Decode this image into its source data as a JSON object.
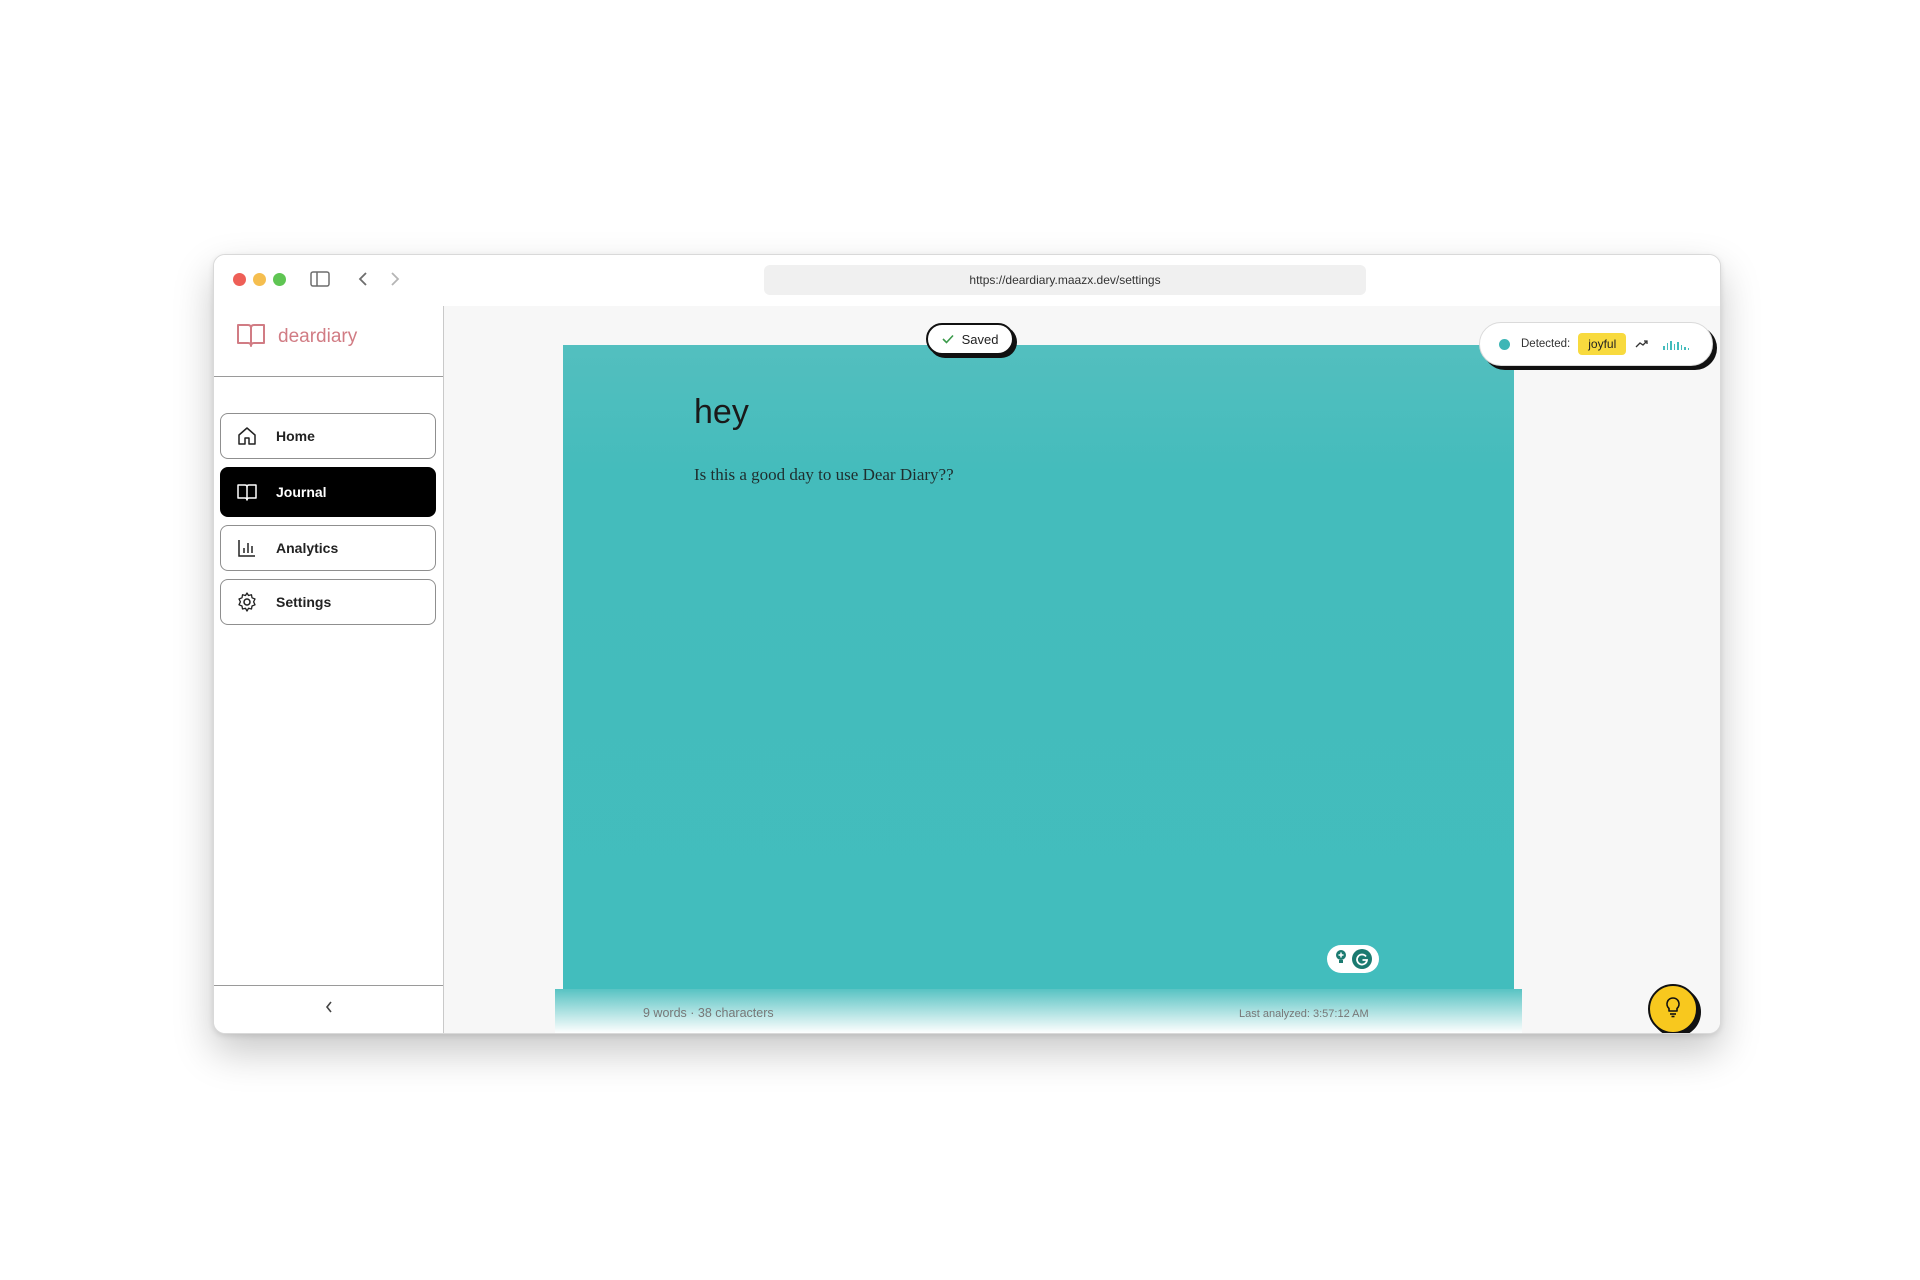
{
  "browser": {
    "url": "https://deardiary.maazx.dev/settings"
  },
  "brand": {
    "name": "deardiary"
  },
  "sidebar": {
    "items": [
      {
        "label": "Home",
        "icon": "home-icon"
      },
      {
        "label": "Journal",
        "icon": "book-icon",
        "active": true
      },
      {
        "label": "Analytics",
        "icon": "bar-chart-icon"
      },
      {
        "label": "Settings",
        "icon": "gear-icon"
      }
    ]
  },
  "save_status": {
    "label": "Saved"
  },
  "mood": {
    "label": "Detected:",
    "value": "joyful"
  },
  "entry": {
    "title": "hey",
    "body": "Is this a good day to use Dear Diary??",
    "stats": "9 words · 38 characters",
    "last_analyzed": "Last analyzed: 3:57:12 AM"
  },
  "colors": {
    "accent": "#d17c84",
    "paper": "#42bdbd",
    "badge": "#f8da3e",
    "fab": "#f8c81e"
  }
}
